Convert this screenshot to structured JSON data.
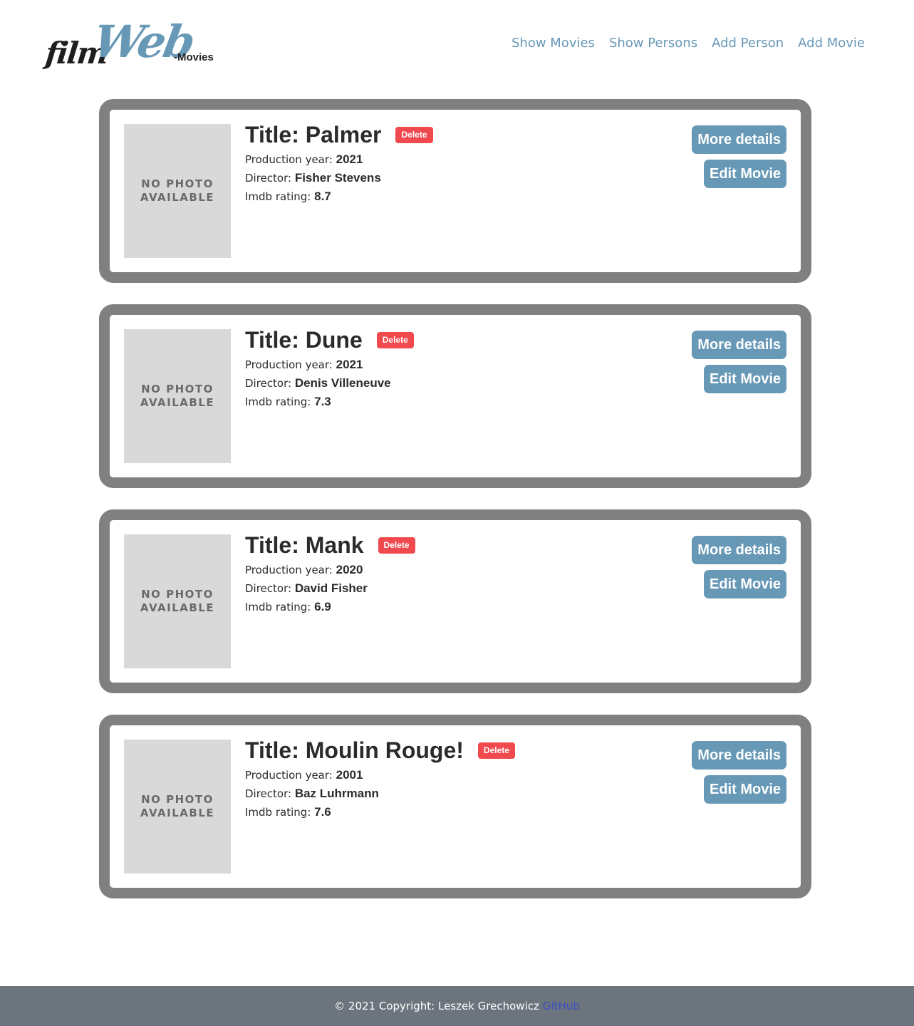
{
  "brand": {
    "logo_film": "film",
    "logo_web": "Web",
    "logo_suffix": "-Movies"
  },
  "nav": {
    "items": [
      {
        "label": "Show Movies"
      },
      {
        "label": "Show Persons"
      },
      {
        "label": "Add Person"
      },
      {
        "label": "Add Movie"
      }
    ]
  },
  "poster": {
    "line1": "NO PHOTO",
    "line2": "AVAILABLE"
  },
  "labels": {
    "production_year": "Production year: ",
    "director": "Director: ",
    "imdb_rating": "Imdb rating: ",
    "delete": "Delete",
    "more_details": "More details",
    "edit_movie": "Edit Movie"
  },
  "movies": [
    {
      "title": "Title: Palmer",
      "year": "2021",
      "director": "Fisher Stevens",
      "rating": "8.7"
    },
    {
      "title": "Title: Dune",
      "year": "2021",
      "director": "Denis Villeneuve",
      "rating": "7.3"
    },
    {
      "title": "Title: Mank",
      "year": "2020",
      "director": "David Fisher",
      "rating": "6.9"
    },
    {
      "title": "Title: Moulin Rouge!",
      "year": "2001",
      "director": "Baz Luhrmann",
      "rating": "7.6"
    }
  ],
  "footer": {
    "copyright": "© 2021 Copyright: Leszek Grechowicz",
    "link": "GitHub"
  },
  "colors": {
    "accent": "#6798b6",
    "delete": "#f04a4f",
    "card_border": "#808080",
    "footer_bg": "#6c757d",
    "footer_link": "#3b4ec2"
  }
}
